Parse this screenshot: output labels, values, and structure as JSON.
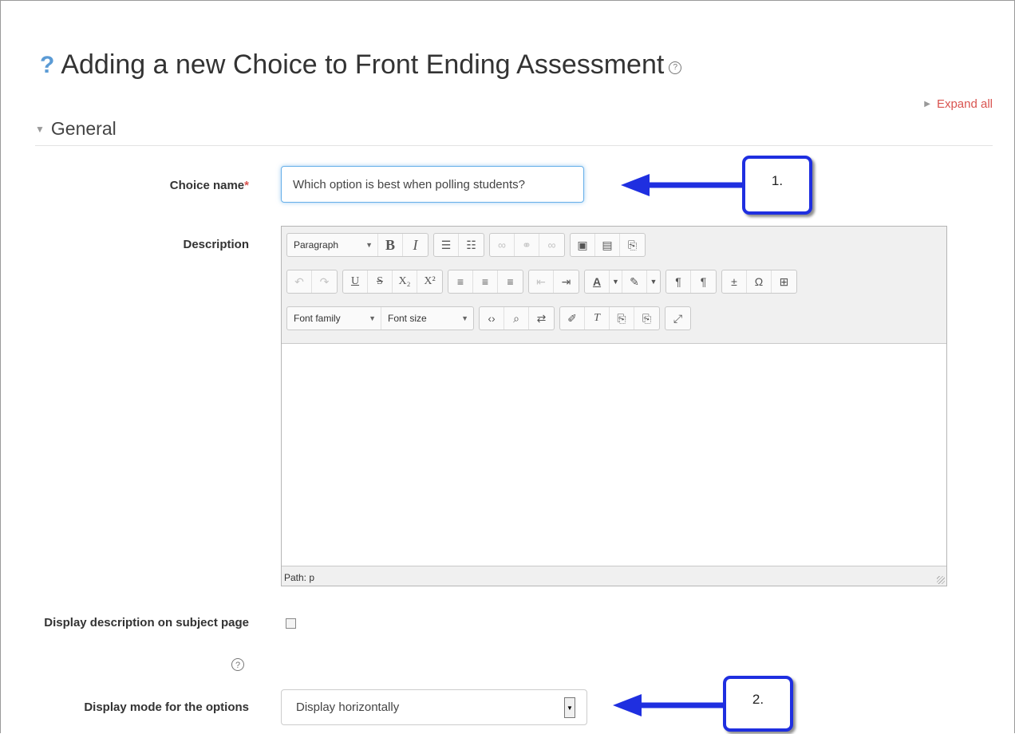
{
  "page": {
    "title": "Adding a new Choice to Front Ending Assessment",
    "expand_all": "Expand all",
    "section": "General"
  },
  "form": {
    "choice_name_label": "Choice name",
    "required_mark": "*",
    "choice_name_value": "Which option is best when polling students?",
    "description_label": "Description",
    "display_description_label": "Display description on subject page",
    "display_mode_label": "Display mode for the options",
    "display_mode_value": "Display horizontally"
  },
  "editor": {
    "paragraph": "Paragraph",
    "font_family": "Font family",
    "font_size": "Font size",
    "path": "Path: p"
  },
  "callouts": {
    "one": "1.",
    "two": "2."
  },
  "colors": {
    "accent_red": "#d9534f",
    "callout_blue": "#1f2fe0",
    "focus_blue": "#66afe9"
  }
}
